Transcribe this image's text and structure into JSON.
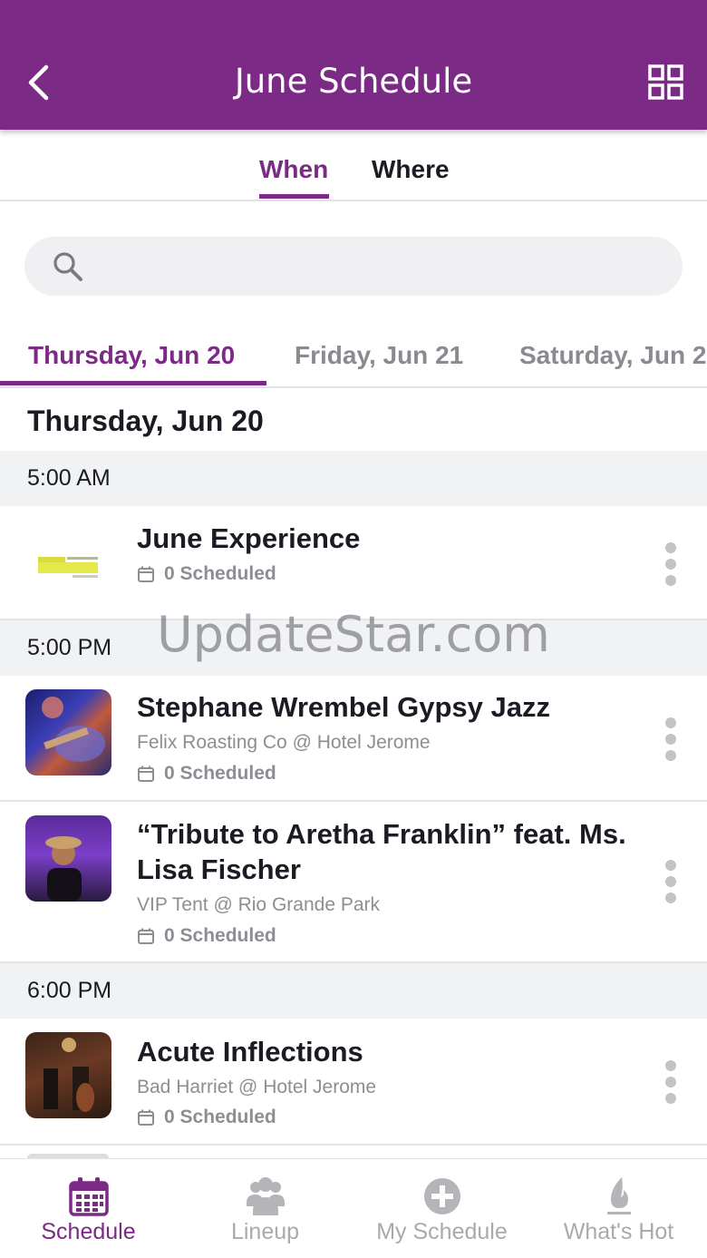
{
  "header": {
    "title": "June Schedule"
  },
  "segments": {
    "when": "When",
    "where": "Where",
    "active": "When"
  },
  "search": {
    "placeholder": ""
  },
  "day_tabs": [
    {
      "label": "Thursday, Jun 20",
      "active": true
    },
    {
      "label": "Friday, Jun 21",
      "active": false
    },
    {
      "label": "Saturday, Jun 2",
      "active": false
    }
  ],
  "date_heading": "Thursday, Jun 20",
  "time_groups": [
    {
      "time": "5:00 AM"
    },
    {
      "time": "5:00 PM"
    },
    {
      "time": "6:00 PM"
    }
  ],
  "events": [
    {
      "title": "June Experience",
      "venue": "",
      "scheduled": "0 Scheduled",
      "thumb": "jas-logo"
    },
    {
      "title": "Stephane Wrembel Gypsy Jazz",
      "venue": "Felix Roasting Co @ Hotel Jerome",
      "scheduled": "0 Scheduled",
      "thumb": "guitar-photo"
    },
    {
      "title": "“Tribute to Aretha Franklin” feat. Ms. Lisa Fischer",
      "venue": "VIP Tent @ Rio Grande Park",
      "scheduled": "0 Scheduled",
      "thumb": "singer-photo"
    },
    {
      "title": "Acute Inflections",
      "venue": "Bad Harriet @ Hotel Jerome",
      "scheduled": "0 Scheduled",
      "thumb": "bar-photo"
    }
  ],
  "watermark": "UpdateStar.com",
  "bottom_nav": [
    {
      "label": "Schedule",
      "icon": "calendar-icon",
      "active": true
    },
    {
      "label": "Lineup",
      "icon": "people-icon",
      "active": false
    },
    {
      "label": "My Schedule",
      "icon": "plus-circle-icon",
      "active": false
    },
    {
      "label": "What's Hot",
      "icon": "flame-icon",
      "active": false
    }
  ],
  "colors": {
    "primary": "#7b2a85",
    "section_bg": "#f1f2f4",
    "muted": "#8d8d93"
  }
}
